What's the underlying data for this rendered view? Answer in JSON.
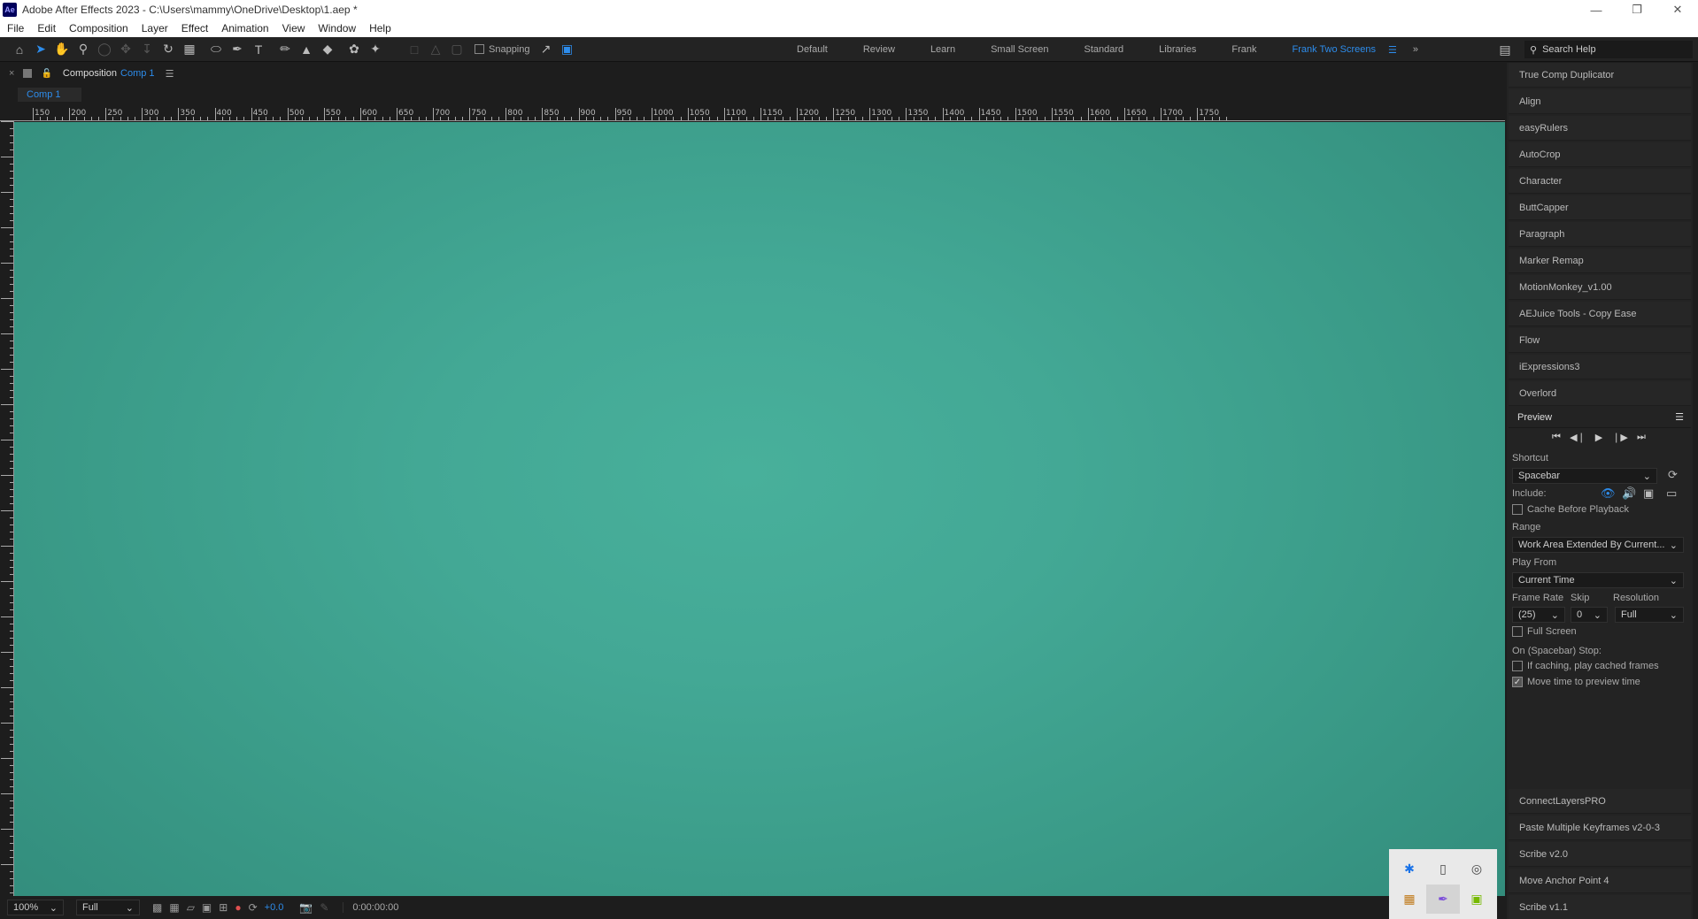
{
  "app": {
    "logo": "Ae",
    "title": "Adobe After Effects 2023 - C:\\Users\\mammy\\OneDrive\\Desktop\\1.aep *",
    "window_controls": [
      "minimize-icon",
      "restore-icon",
      "close-icon"
    ]
  },
  "menu": [
    "File",
    "Edit",
    "Composition",
    "Layer",
    "Effect",
    "Animation",
    "View",
    "Window",
    "Help"
  ],
  "toolbar": {
    "snapping_label": "Snapping",
    "workspaces": [
      "Default",
      "Review",
      "Learn",
      "Small Screen",
      "Standard",
      "Libraries",
      "Frank",
      "Frank Two Screens"
    ],
    "active_workspace": "Frank Two Screens",
    "search_placeholder": "Search Help"
  },
  "composition": {
    "panel_label": "Composition",
    "comp_name": "Comp 1",
    "tab": "Comp 1",
    "ruler_labels": [
      "150",
      "200",
      "250",
      "300",
      "350",
      "400",
      "450",
      "500",
      "550",
      "600",
      "650",
      "700",
      "750",
      "800",
      "850",
      "900",
      "950",
      "1000",
      "1050",
      "1100",
      "1150",
      "1200",
      "1250",
      "1300",
      "1350",
      "1400",
      "1450",
      "1500",
      "1550",
      "1600",
      "1650",
      "1700",
      "1750"
    ],
    "background_color": "#43a895"
  },
  "comp_bottom": {
    "zoom": "100%",
    "resolution": "Full",
    "exposure": "+0.0",
    "timecode": "0:00:00:00"
  },
  "scripts_top": [
    "True Comp Duplicator",
    "Align",
    "easyRulers",
    "AutoCrop",
    "Character",
    "ButtCapper",
    "Paragraph",
    "Marker Remap",
    "MotionMonkey_v1.00",
    "AEJuice Tools - Copy Ease",
    "Flow",
    "iExpressions3",
    "Overlord"
  ],
  "preview": {
    "title": "Preview",
    "shortcut_label": "Shortcut",
    "shortcut_value": "Spacebar",
    "include_label": "Include:",
    "cache_before_playback": "Cache Before Playback",
    "range_label": "Range",
    "range_value": "Work Area Extended By Current...",
    "play_from_label": "Play From",
    "play_from_value": "Current Time",
    "frame_rate_label": "Frame Rate",
    "skip_label": "Skip",
    "resolution_label": "Resolution",
    "frame_rate_value": "(25)",
    "skip_value": "0",
    "resolution_value": "Full",
    "full_screen": "Full Screen",
    "on_stop_label": "On (Spacebar) Stop:",
    "if_caching": "If caching, play cached frames",
    "move_time": "Move time to preview time",
    "move_time_checked": true
  },
  "scripts_bottom": [
    "ConnectLayersPRO",
    "Paste Multiple Keyframes v2-0-3",
    "Scribe v2.0",
    "Move Anchor Point 4",
    "Scribe v1.1"
  ],
  "tray_icons": [
    "bluetooth-icon",
    "usb-drive-icon",
    "network-icon",
    "app-icon",
    "pen-icon",
    "nvidia-icon"
  ]
}
